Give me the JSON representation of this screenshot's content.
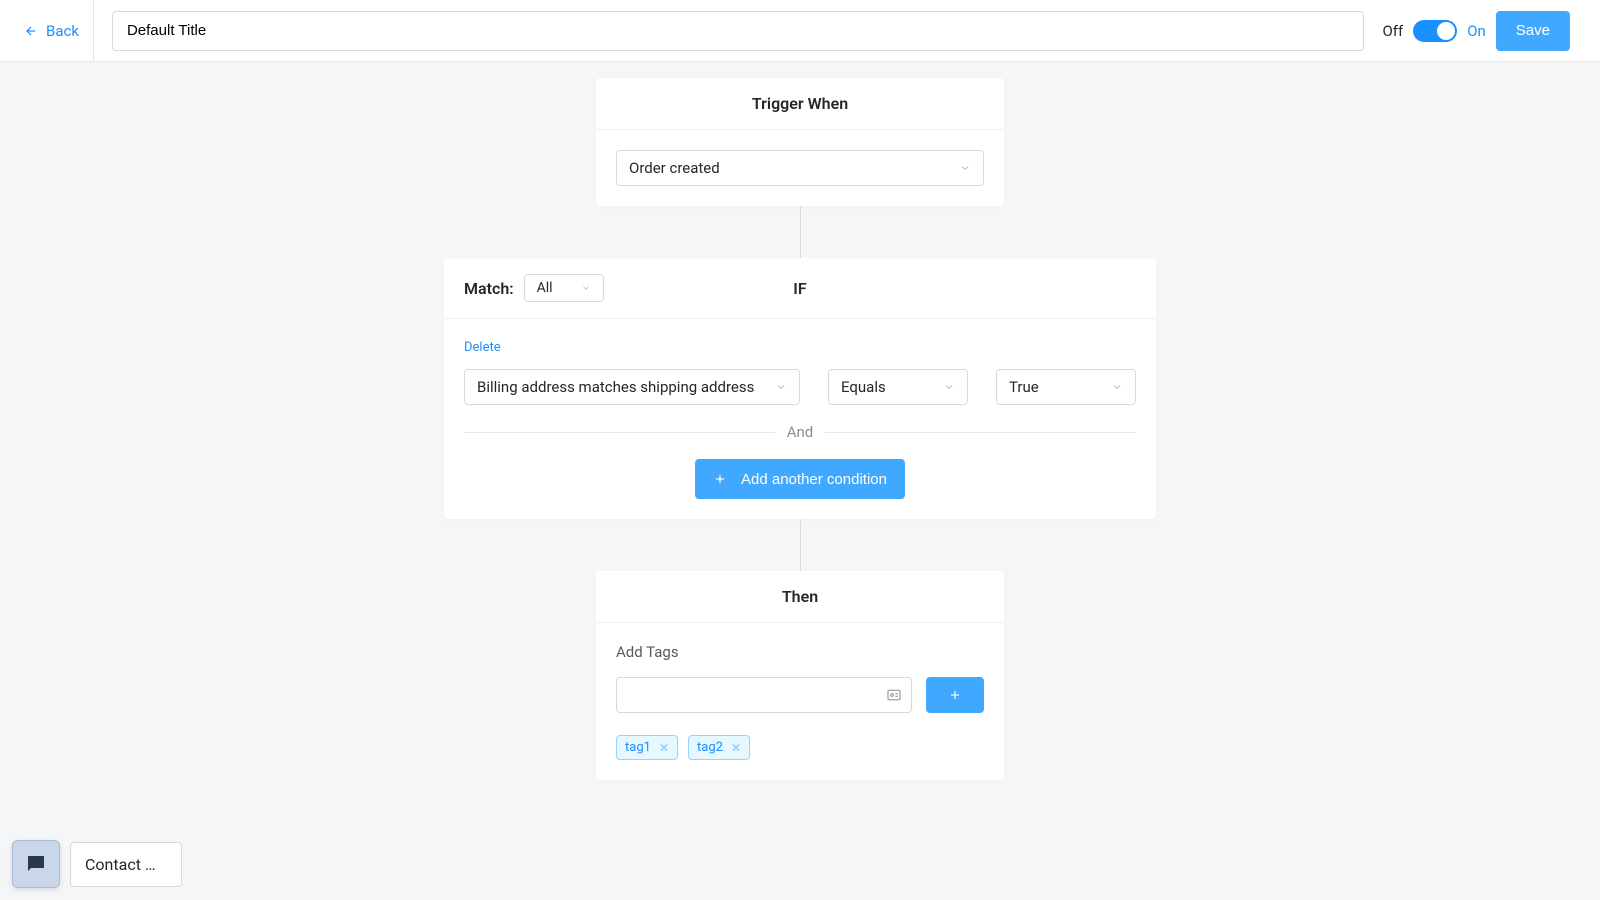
{
  "header": {
    "back_label": "Back",
    "title_value": "Default Title",
    "off_label": "Off",
    "on_label": "On",
    "save_label": "Save"
  },
  "trigger": {
    "title": "Trigger When",
    "event": "Order created"
  },
  "if": {
    "match_label": "Match:",
    "match_value": "All",
    "title": "IF",
    "delete_label": "Delete",
    "condition": {
      "field": "Billing address matches shipping address",
      "operator": "Equals",
      "value": "True"
    },
    "and_label": "And",
    "add_label": "Add another condition"
  },
  "then": {
    "title": "Then",
    "add_tags_label": "Add Tags",
    "tags": [
      "tag1",
      "tag2"
    ]
  },
  "chat": {
    "label": "Contact …"
  }
}
